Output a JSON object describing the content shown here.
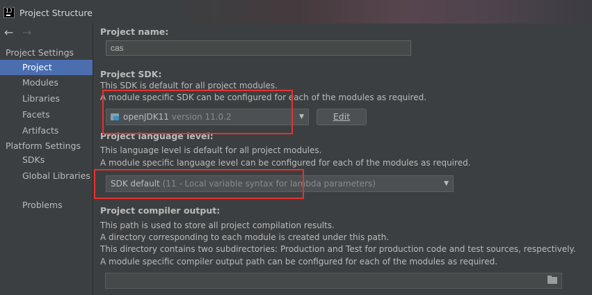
{
  "window": {
    "title": "Project Structure"
  },
  "sidebar": {
    "group_settings": "Project Settings",
    "items_settings": [
      "Project",
      "Modules",
      "Libraries",
      "Facets",
      "Artifacts"
    ],
    "group_platform": "Platform Settings",
    "items_platform": [
      "SDKs",
      "Global Libraries"
    ],
    "problems": "Problems",
    "selected": "Project"
  },
  "project_name": {
    "label": "Project name:",
    "value": "cas"
  },
  "project_sdk": {
    "label": "Project SDK:",
    "desc1": "This SDK is default for all project modules.",
    "desc2": "A module specific SDK can be configured for each of the modules as required.",
    "selected_name": "openJDK11",
    "selected_version": "version 11.0.2",
    "edit_label": "Edit"
  },
  "language_level": {
    "label": "Project language level:",
    "desc1": "This language level is default for all project modules.",
    "desc2": "A module specific language level can be configured for each of the modules as required.",
    "selected": "SDK default",
    "selected_detail": "(11 - Local variable syntax for lambda parameters)"
  },
  "compiler_output": {
    "label": "Project compiler output:",
    "desc1": "This path is used to store all project compilation results.",
    "desc2": "A directory corresponding to each module is created under this path.",
    "desc3": "This directory contains two subdirectories: Production and Test for production code and test sources, respectively.",
    "desc4": "A module specific compiler output path can be configured for each of the modules as required.",
    "value": ""
  },
  "colors": {
    "background": "#3c3f41",
    "selection": "#4b6eaf",
    "highlight_box": "#e8312e"
  }
}
